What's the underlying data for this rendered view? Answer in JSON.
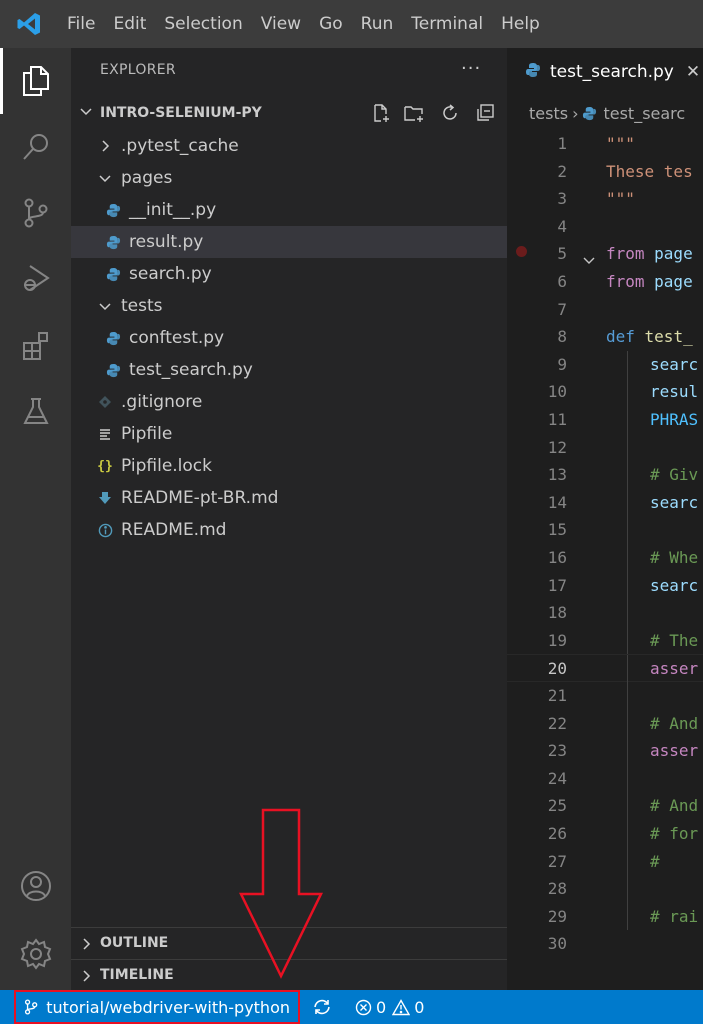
{
  "menu": [
    "File",
    "Edit",
    "Selection",
    "View",
    "Go",
    "Run",
    "Terminal",
    "Help"
  ],
  "explorer": {
    "title": "EXPLORER",
    "more": "···",
    "root": "INTRO-SELENIUM-PY",
    "tree": [
      {
        "label": ".pytest_cache",
        "type": "folder",
        "depth": 1,
        "open": false
      },
      {
        "label": "pages",
        "type": "folder",
        "depth": 1,
        "open": true
      },
      {
        "label": "__init__.py",
        "type": "python",
        "depth": 2
      },
      {
        "label": "result.py",
        "type": "python",
        "depth": 2,
        "selected": true
      },
      {
        "label": "search.py",
        "type": "python",
        "depth": 2
      },
      {
        "label": "tests",
        "type": "folder",
        "depth": 1,
        "open": true
      },
      {
        "label": "conftest.py",
        "type": "python",
        "depth": 2
      },
      {
        "label": "test_search.py",
        "type": "python",
        "depth": 2
      },
      {
        "label": ".gitignore",
        "type": "git",
        "depth": 1
      },
      {
        "label": "Pipfile",
        "type": "text",
        "depth": 1
      },
      {
        "label": "Pipfile.lock",
        "type": "json",
        "depth": 1
      },
      {
        "label": "README-pt-BR.md",
        "type": "markdown",
        "depth": 1
      },
      {
        "label": "README.md",
        "type": "info",
        "depth": 1
      }
    ],
    "outline": "OUTLINE",
    "timeline": "TIMELINE"
  },
  "editor": {
    "tab_label": "test_search.py",
    "tab_close": "✕",
    "breadcrumb": {
      "folder": "tests",
      "separator": "›",
      "file": "test_searc"
    },
    "lines": [
      {
        "n": "1",
        "text": "\"\"\"",
        "cls": "t-str",
        "indent": 0
      },
      {
        "n": "2",
        "text": "These tes",
        "cls": "t-str",
        "indent": 0
      },
      {
        "n": "3",
        "text": "\"\"\"",
        "cls": "t-str",
        "indent": 0
      },
      {
        "n": "4",
        "text": "",
        "cls": "",
        "indent": 0
      },
      {
        "n": "5",
        "kw": "from",
        "rest": " page",
        "indent": 0,
        "breakpoint": true,
        "fold": true
      },
      {
        "n": "6",
        "kw": "from",
        "rest": " page",
        "indent": 0
      },
      {
        "n": "7",
        "text": "",
        "cls": "",
        "indent": 0
      },
      {
        "n": "8",
        "kw": "def",
        "rest": " test_",
        "indent": 0,
        "def": true
      },
      {
        "n": "9",
        "text": "searc",
        "cls": "t-var",
        "indent": 1
      },
      {
        "n": "10",
        "text": "resul",
        "cls": "t-var",
        "indent": 1
      },
      {
        "n": "11",
        "text": "PHRAS",
        "cls": "t-const",
        "indent": 1
      },
      {
        "n": "12",
        "text": "",
        "cls": "",
        "indent": 1
      },
      {
        "n": "13",
        "text": "# Giv",
        "cls": "t-cmt",
        "indent": 1
      },
      {
        "n": "14",
        "text": "searc",
        "cls": "t-var",
        "indent": 1
      },
      {
        "n": "15",
        "text": "",
        "cls": "",
        "indent": 1
      },
      {
        "n": "16",
        "text": "# Whe",
        "cls": "t-cmt",
        "indent": 1
      },
      {
        "n": "17",
        "text": "searc",
        "cls": "t-var",
        "indent": 1
      },
      {
        "n": "18",
        "text": "",
        "cls": "",
        "indent": 1
      },
      {
        "n": "19",
        "text": "# The",
        "cls": "t-cmt",
        "indent": 1
      },
      {
        "n": "20",
        "text": "asser",
        "cls": "t-kw",
        "indent": 1,
        "current": true
      },
      {
        "n": "21",
        "text": "",
        "cls": "",
        "indent": 1
      },
      {
        "n": "22",
        "text": "# And",
        "cls": "t-cmt",
        "indent": 1
      },
      {
        "n": "23",
        "text": "asser",
        "cls": "t-kw",
        "indent": 1
      },
      {
        "n": "24",
        "text": "",
        "cls": "",
        "indent": 1
      },
      {
        "n": "25",
        "text": "# And",
        "cls": "t-cmt",
        "indent": 1
      },
      {
        "n": "26",
        "text": "# for",
        "cls": "t-cmt",
        "indent": 1
      },
      {
        "n": "27",
        "text": "#",
        "cls": "t-cmt",
        "indent": 1
      },
      {
        "n": "28",
        "text": "",
        "cls": "",
        "indent": 1
      },
      {
        "n": "29",
        "text": "# rai",
        "cls": "t-cmt",
        "indent": 1
      },
      {
        "n": "30",
        "text": "",
        "cls": "",
        "indent": 0
      }
    ]
  },
  "statusbar": {
    "branch": "tutorial/webdriver-with-python",
    "errors": "0",
    "warnings": "0"
  },
  "colors": {
    "accent": "#007acc",
    "annotation": "#e81123"
  }
}
